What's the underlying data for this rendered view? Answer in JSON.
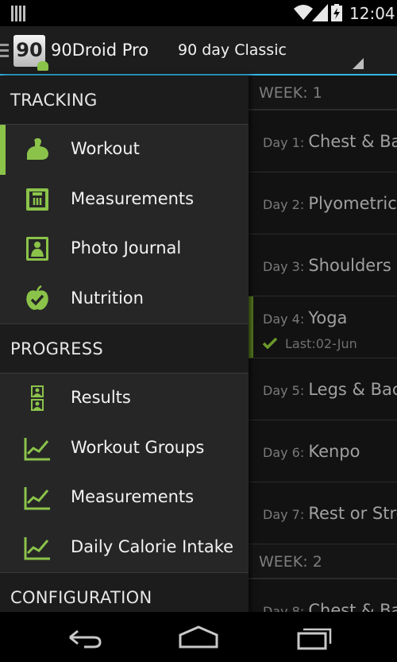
{
  "status_bar": {
    "time": "12:04"
  },
  "action_bar": {
    "app_title": "90Droid Pro",
    "app_icon_text": "90",
    "program_selected": "90 day Classic"
  },
  "drawer": {
    "sections": [
      {
        "title": "TRACKING"
      },
      {
        "title": "PROGRESS"
      },
      {
        "title": "CONFIGURATION"
      }
    ],
    "tracking_items": [
      {
        "label": "Workout",
        "icon": "bicep-icon"
      },
      {
        "label": "Measurements",
        "icon": "scale-icon"
      },
      {
        "label": "Photo Journal",
        "icon": "photo-portrait-icon"
      },
      {
        "label": "Nutrition",
        "icon": "apple-check-icon"
      }
    ],
    "progress_items": [
      {
        "label": "Results",
        "icon": "results-icon"
      },
      {
        "label": "Workout Groups",
        "icon": "chart-icon"
      },
      {
        "label": "Measurements",
        "icon": "chart-icon"
      },
      {
        "label": "Daily Calorie Intake",
        "icon": "chart-icon"
      }
    ]
  },
  "schedule": {
    "week1_label": "WEEK: 1",
    "week2_label": "WEEK: 2",
    "days": [
      {
        "num": "Day 1:",
        "name": "Chest & Back"
      },
      {
        "num": "Day 2:",
        "name": "Plyometrics"
      },
      {
        "num": "Day 3:",
        "name": "Shoulders & Arms"
      },
      {
        "num": "Day 4:",
        "name": "Yoga",
        "last": "Last:02-Jun"
      },
      {
        "num": "Day 5:",
        "name": "Legs & Back"
      },
      {
        "num": "Day 6:",
        "name": "Kenpo"
      },
      {
        "num": "Day 7:",
        "name": "Rest or Stretch"
      },
      {
        "num": "Day 8:",
        "name": "Chest & Back"
      }
    ]
  },
  "colors": {
    "accent_green": "#8bc34a",
    "holo_blue": "#33b5e5"
  }
}
